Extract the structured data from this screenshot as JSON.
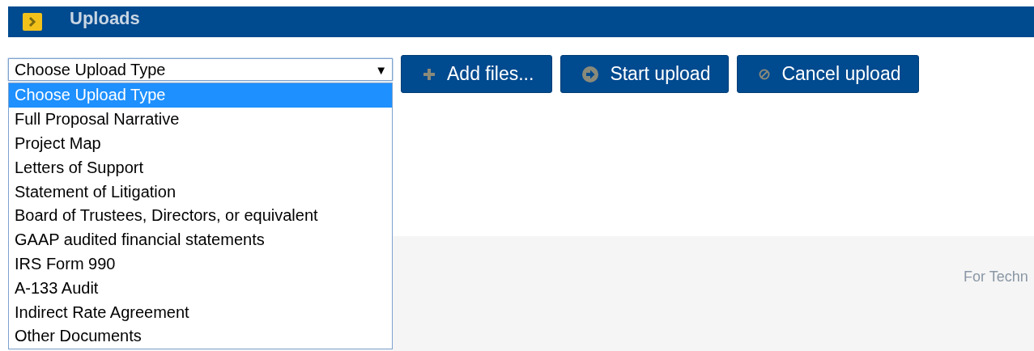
{
  "header": {
    "title": "Uploads"
  },
  "upload_type_select": {
    "value": "Choose Upload Type",
    "arrow": "▼",
    "expanded": true,
    "options": [
      {
        "label": "Choose Upload Type",
        "selected": true
      },
      {
        "label": "Full Proposal Narrative",
        "selected": false
      },
      {
        "label": "Project Map",
        "selected": false
      },
      {
        "label": "Letters of Support",
        "selected": false
      },
      {
        "label": "Statement of Litigation",
        "selected": false
      },
      {
        "label": "Board of Trustees, Directors, or equivalent",
        "selected": false
      },
      {
        "label": "GAAP audited financial statements",
        "selected": false
      },
      {
        "label": "IRS Form 990",
        "selected": false
      },
      {
        "label": "A-133 Audit",
        "selected": false
      },
      {
        "label": "Indirect Rate Agreement",
        "selected": false
      },
      {
        "label": "Other Documents",
        "selected": false
      }
    ]
  },
  "buttons": [
    {
      "kind": "add",
      "label": "Add files..."
    },
    {
      "kind": "start",
      "label": "Start upload"
    },
    {
      "kind": "cancel",
      "label": "Cancel upload"
    }
  ],
  "footer": {
    "text": "For Techn"
  }
}
